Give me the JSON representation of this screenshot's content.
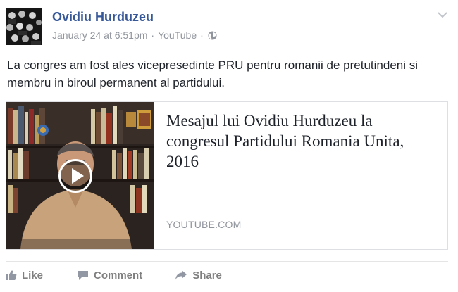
{
  "post": {
    "author": "Ovidiu Hurduzeu",
    "timestamp": "January 24 at 6:51pm",
    "separator": "·",
    "source": "YouTube",
    "privacy_icon": "globe-icon",
    "menu_icon": "chevron-down-icon",
    "text": "La congres am fost ales vicepresedinte PRU pentru romanii de pretutindeni si membru in biroul permanent al partidului."
  },
  "link_card": {
    "title": "Mesajul lui Ovidiu Hurduzeu la congresul Partidului Romania Unita, 2016",
    "source": "YOUTUBE.COM",
    "media": "video-thumbnail",
    "play_icon": "play-icon"
  },
  "actions": {
    "like_label": "Like",
    "comment_label": "Comment",
    "share_label": "Share"
  },
  "colors": {
    "author": "#365899",
    "meta": "#90949c",
    "action": "#7f7f7f",
    "border": "#dddfe2"
  }
}
